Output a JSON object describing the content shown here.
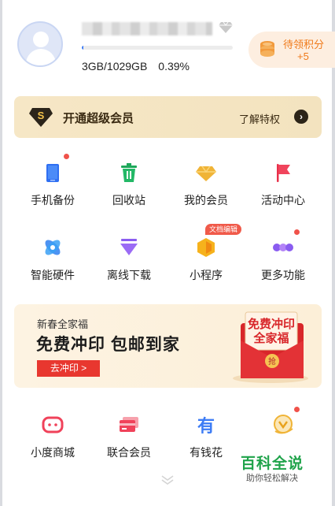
{
  "profile": {
    "storage_used": "3GB/1029GB",
    "storage_percent": "0.39%",
    "storage_fraction": 0.0039
  },
  "points": {
    "label": "待领积分",
    "value": "+5"
  },
  "member_banner": {
    "title": "开通超级会员",
    "link": "了解特权"
  },
  "grid_row1": [
    {
      "label": "手机备份",
      "icon": "phone-backup-icon",
      "dot": true
    },
    {
      "label": "回收站",
      "icon": "recycle-bin-icon",
      "dot": false
    },
    {
      "label": "我的会员",
      "icon": "member-diamond-icon",
      "dot": false
    },
    {
      "label": "活动中心",
      "icon": "flag-icon",
      "dot": false
    }
  ],
  "grid_row2": [
    {
      "label": "智能硬件",
      "icon": "smart-hardware-icon",
      "dot": false
    },
    {
      "label": "离线下载",
      "icon": "offline-download-icon",
      "dot": false
    },
    {
      "label": "小程序",
      "icon": "mini-program-icon",
      "dot": false,
      "badge": "文档编辑"
    },
    {
      "label": "更多功能",
      "icon": "more-functions-icon",
      "dot": true
    }
  ],
  "print_banner": {
    "subtitle": "新春全家福",
    "title": "免费冲印 包邮到家",
    "button": "去冲印 >",
    "envelope_line1": "免费冲印",
    "envelope_line2": "全家福",
    "envelope_seal": "抢"
  },
  "grid_row3": [
    {
      "label": "小度商城",
      "icon": "xiaodu-mall-icon",
      "dot": false
    },
    {
      "label": "联合会员",
      "icon": "joint-member-card-icon",
      "dot": false
    },
    {
      "label": "有钱花",
      "icon": "youqianhua-icon",
      "dot": false
    },
    {
      "label": "",
      "icon": "finance-icon",
      "dot": true
    }
  ],
  "watermark": {
    "main": "百科全说",
    "sub": "助你轻松解决"
  },
  "colors": {
    "accent_blue": "#3d7cf5",
    "points_orange": "#f07a1a",
    "member_gold": "#f6e7c6",
    "alert_red": "#e8372f",
    "watermark_green": "#1fa34a"
  }
}
